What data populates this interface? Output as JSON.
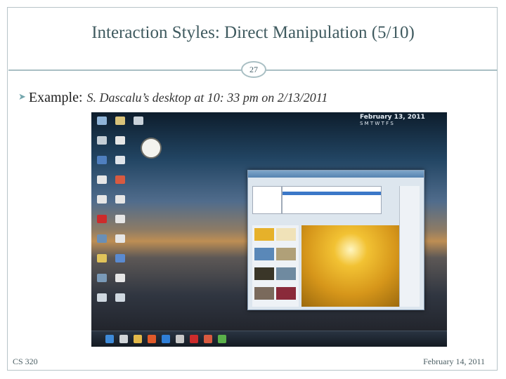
{
  "slide": {
    "title": "Interaction Styles: Direct Manipulation (5/10)",
    "number": "27",
    "bullet_lead": "Example:",
    "bullet_detail": "S. Dascalu’s desktop at 10: 33 pm on 2/13/2011",
    "bullet_glyph": "bullet-arrow-icon",
    "footer_left": "CS 320",
    "footer_right": "February 14, 2011"
  },
  "screenshot": {
    "calendar_header": "February 13, 2011",
    "calendar_days": "S M T W T F S"
  },
  "colors": {
    "title": "#3f5a5f",
    "rule": "#a9bfc4",
    "accent": "#74a6ad"
  }
}
